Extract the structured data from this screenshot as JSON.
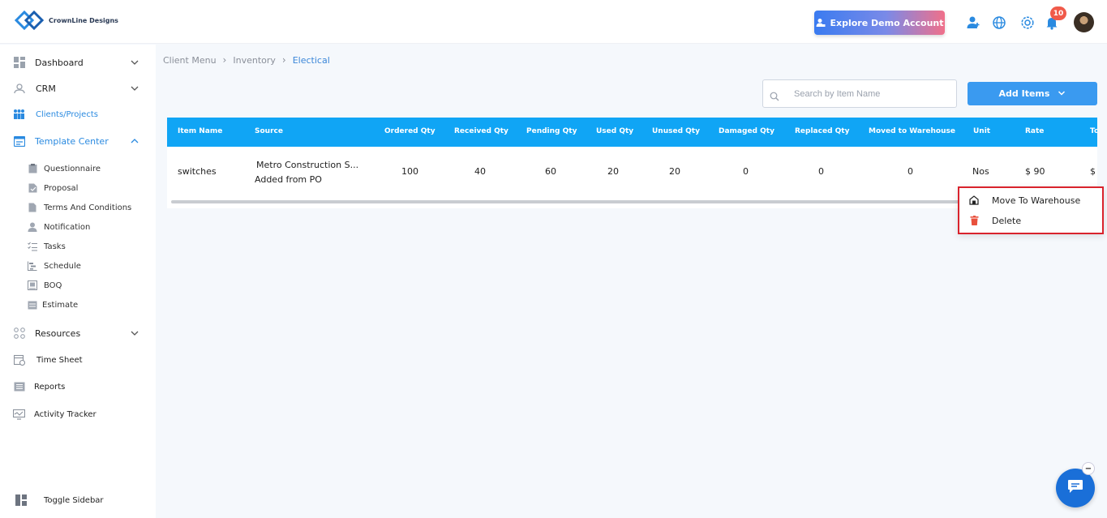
{
  "header": {
    "brand": "CrownLine Designs",
    "explore_label": "Explore Demo Account",
    "notification_count": "10"
  },
  "sidebar": {
    "items": [
      {
        "label": "Dashboard",
        "icon": "dashboard-icon"
      },
      {
        "label": "CRM",
        "icon": "crm-icon"
      },
      {
        "label": "Clients/Projects",
        "icon": "clients-icon"
      },
      {
        "label": "Template Center",
        "icon": "template-icon"
      },
      {
        "label": "Resources",
        "icon": "resources-icon"
      },
      {
        "label": "Time Sheet",
        "icon": "timesheet-icon"
      },
      {
        "label": "Reports",
        "icon": "reports-icon"
      },
      {
        "label": "Activity Tracker",
        "icon": "activity-icon"
      }
    ],
    "sub_items": [
      {
        "label": "Questionnaire"
      },
      {
        "label": "Proposal"
      },
      {
        "label": "Terms And Conditions"
      },
      {
        "label": "Notification"
      },
      {
        "label": "Tasks"
      },
      {
        "label": "Schedule"
      },
      {
        "label": "BOQ"
      },
      {
        "label": "Estimate"
      }
    ],
    "toggle_label": "Toggle Sidebar"
  },
  "breadcrumb": {
    "items": [
      "Client Menu",
      "Inventory",
      "Electical"
    ]
  },
  "search": {
    "placeholder": "Search by Item Name"
  },
  "add_items_label": "Add Items",
  "table": {
    "headers": [
      "Item Name",
      "Source",
      "Ordered Qty",
      "Received Qty",
      "Pending Qty",
      "Used Qty",
      "Unused Qty",
      "Damaged Qty",
      "Replaced Qty",
      "Moved to Warehouse",
      "Unit",
      "Rate",
      "To"
    ],
    "row": {
      "item_name": "switches",
      "source_line1": "Metro Construction S...",
      "source_line2": "Added from PO",
      "ordered": "100",
      "received": "40",
      "pending": "60",
      "used": "20",
      "unused": "20",
      "damaged": "0",
      "replaced": "0",
      "moved": "0",
      "unit": "Nos",
      "rate": "$ 90",
      "total": "$"
    }
  },
  "context_menu": {
    "move_label": "Move To Warehouse",
    "delete_label": "Delete"
  },
  "colors": {
    "accent": "#3a9af0",
    "table_header": "#10a5f5",
    "danger": "#d9232d",
    "badge": "#f05a4a"
  }
}
